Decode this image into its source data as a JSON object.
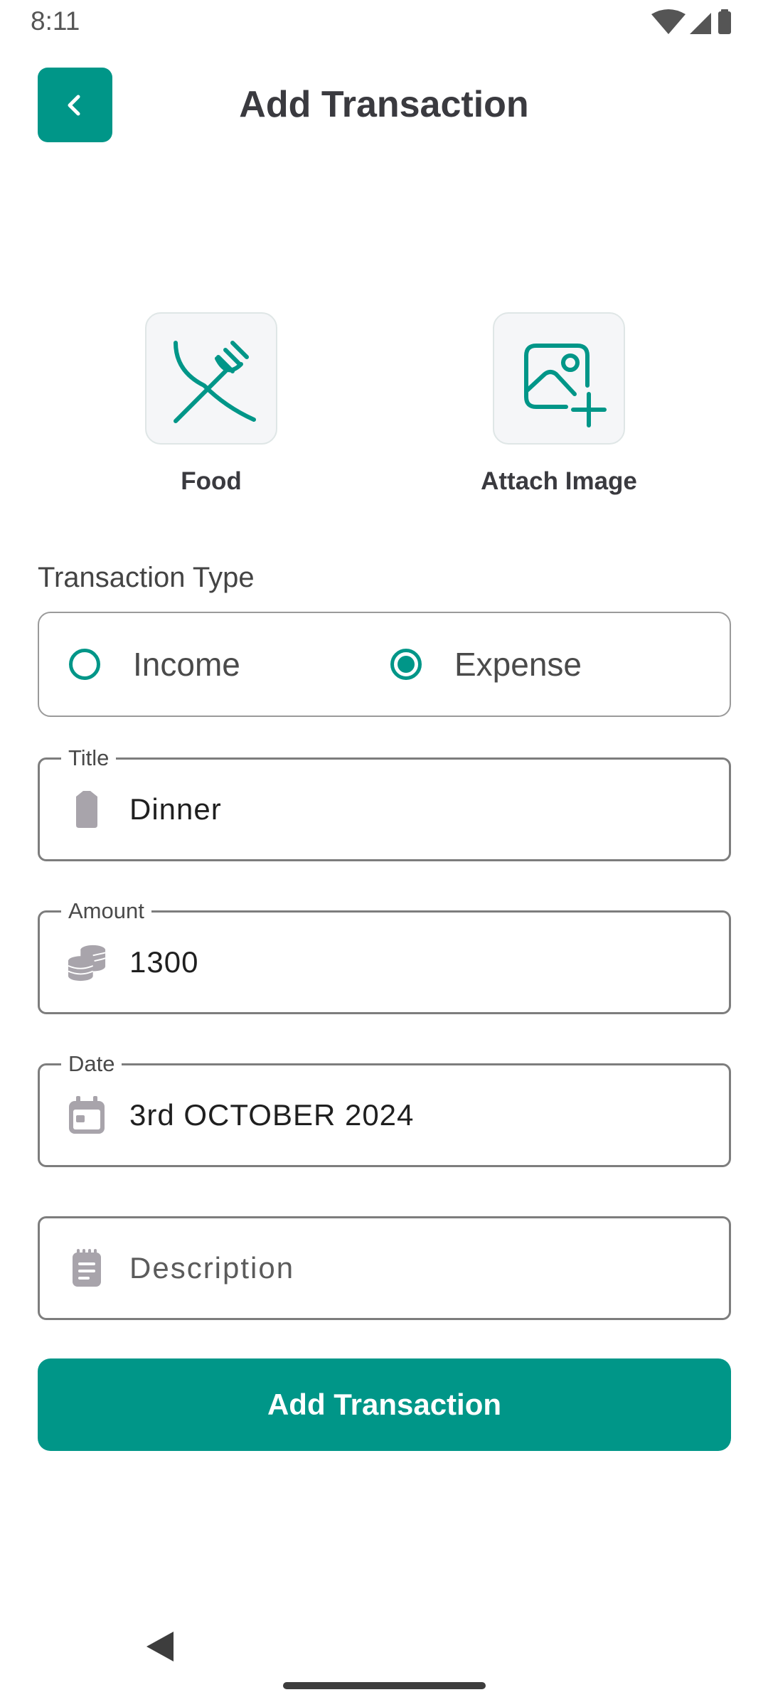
{
  "status_bar": {
    "time": "8:11",
    "icons": [
      "wifi-icon",
      "signal-icon",
      "battery-icon"
    ]
  },
  "header": {
    "back_icon": "chevron-left-icon",
    "title": "Add Transaction"
  },
  "tiles": {
    "category": {
      "label": "Food",
      "icon": "fork-knife-icon"
    },
    "attach": {
      "label": "Attach Image",
      "icon": "image-add-icon"
    }
  },
  "transaction_type": {
    "label": "Transaction Type",
    "options": [
      {
        "label": "Income",
        "selected": false
      },
      {
        "label": "Expense",
        "selected": true
      }
    ]
  },
  "form": {
    "title": {
      "label": "Title",
      "value": "Dinner",
      "icon": "tag-icon"
    },
    "amount": {
      "label": "Amount",
      "value": "1300",
      "icon": "coins-icon"
    },
    "date": {
      "label": "Date",
      "value": "3rd OCTOBER 2024",
      "icon": "calendar-icon"
    },
    "description": {
      "placeholder": "Description",
      "icon": "notepad-icon"
    }
  },
  "submit_label": "Add Transaction",
  "colors": {
    "accent": "#009688",
    "text": "#3a3a3f",
    "icon_gray": "#a8a4ab"
  }
}
